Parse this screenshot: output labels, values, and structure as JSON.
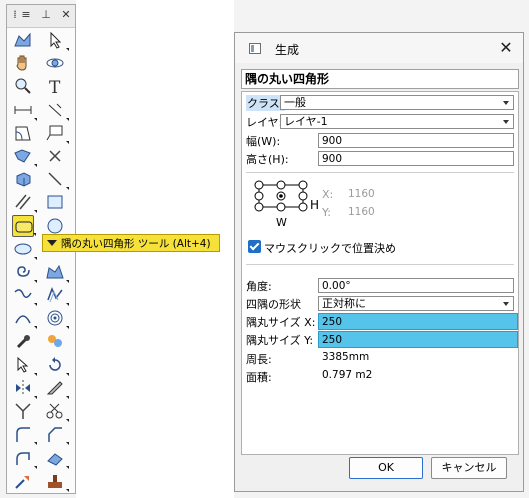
{
  "palette": {
    "tools": [
      {
        "name": "polyline-icon"
      },
      {
        "name": "arrow-select-icon"
      },
      {
        "name": "pan-hand-icon"
      },
      {
        "name": "flyover-icon"
      },
      {
        "name": "zoom-icon"
      },
      {
        "name": "text-icon"
      },
      {
        "name": "dimension-icon"
      },
      {
        "name": "angle-dimension-icon"
      },
      {
        "name": "sheet-icon"
      },
      {
        "name": "callout-icon"
      },
      {
        "name": "trim-icon"
      },
      {
        "name": "cross-icon"
      },
      {
        "name": "extrude-icon"
      },
      {
        "name": "line-icon"
      },
      {
        "name": "double-line-icon"
      },
      {
        "name": "rectangle-icon"
      },
      {
        "name": "rounded-rectangle-icon"
      },
      {
        "name": "circle-icon"
      },
      {
        "name": "oval-icon"
      },
      {
        "name": "x"
      },
      {
        "name": "spiral-icon"
      },
      {
        "name": "polygon-icon"
      },
      {
        "name": "freehand-icon"
      },
      {
        "name": "offset-icon"
      },
      {
        "name": "arc-icon"
      },
      {
        "name": "concentric-icon"
      },
      {
        "name": "eyedropper-icon"
      },
      {
        "name": "attribute-icon"
      },
      {
        "name": "pointer-icon"
      },
      {
        "name": "rotate-icon"
      },
      {
        "name": "mirror-icon"
      },
      {
        "name": "knife-icon"
      },
      {
        "name": "split-icon"
      },
      {
        "name": "scissors-icon"
      },
      {
        "name": "fillet-icon"
      },
      {
        "name": "chamfer-icon"
      },
      {
        "name": "connect-icon"
      },
      {
        "name": "eraser-icon"
      },
      {
        "name": "move-icon"
      },
      {
        "name": "stamp-icon"
      }
    ]
  },
  "tooltip": {
    "text": "隅の丸い四角形 ツール (Alt+4)"
  },
  "dialog": {
    "title": "生成",
    "object_name": "隅の丸い四角形",
    "class_label": "クラス:",
    "class_value": "一般",
    "layer_label": "レイヤ:",
    "layer_value": "レイヤ-1",
    "width_label": "幅(W):",
    "width_value": "900",
    "height_label": "高さ(H):",
    "height_value": "900",
    "x_label": "X:",
    "x_value": "1160",
    "y_label": "Y:",
    "y_value": "1160",
    "anchor_h": "H",
    "anchor_w": "W",
    "checkbox_label": "マウスクリックで位置決め",
    "angle_label": "角度:",
    "angle_value": "0.00°",
    "corner_shape_label": "四隅の形状",
    "corner_shape_value": "正対称に",
    "radius_x_label": "隅丸サイズ X:",
    "radius_x_value": "250",
    "radius_y_label": "隅丸サイズ Y:",
    "radius_y_value": "250",
    "perimeter_label": "周長:",
    "perimeter_value": "3385mm",
    "area_label": "面積:",
    "area_value": "0.797 m2",
    "ok_label": "OK",
    "cancel_label": "キャンセル"
  }
}
